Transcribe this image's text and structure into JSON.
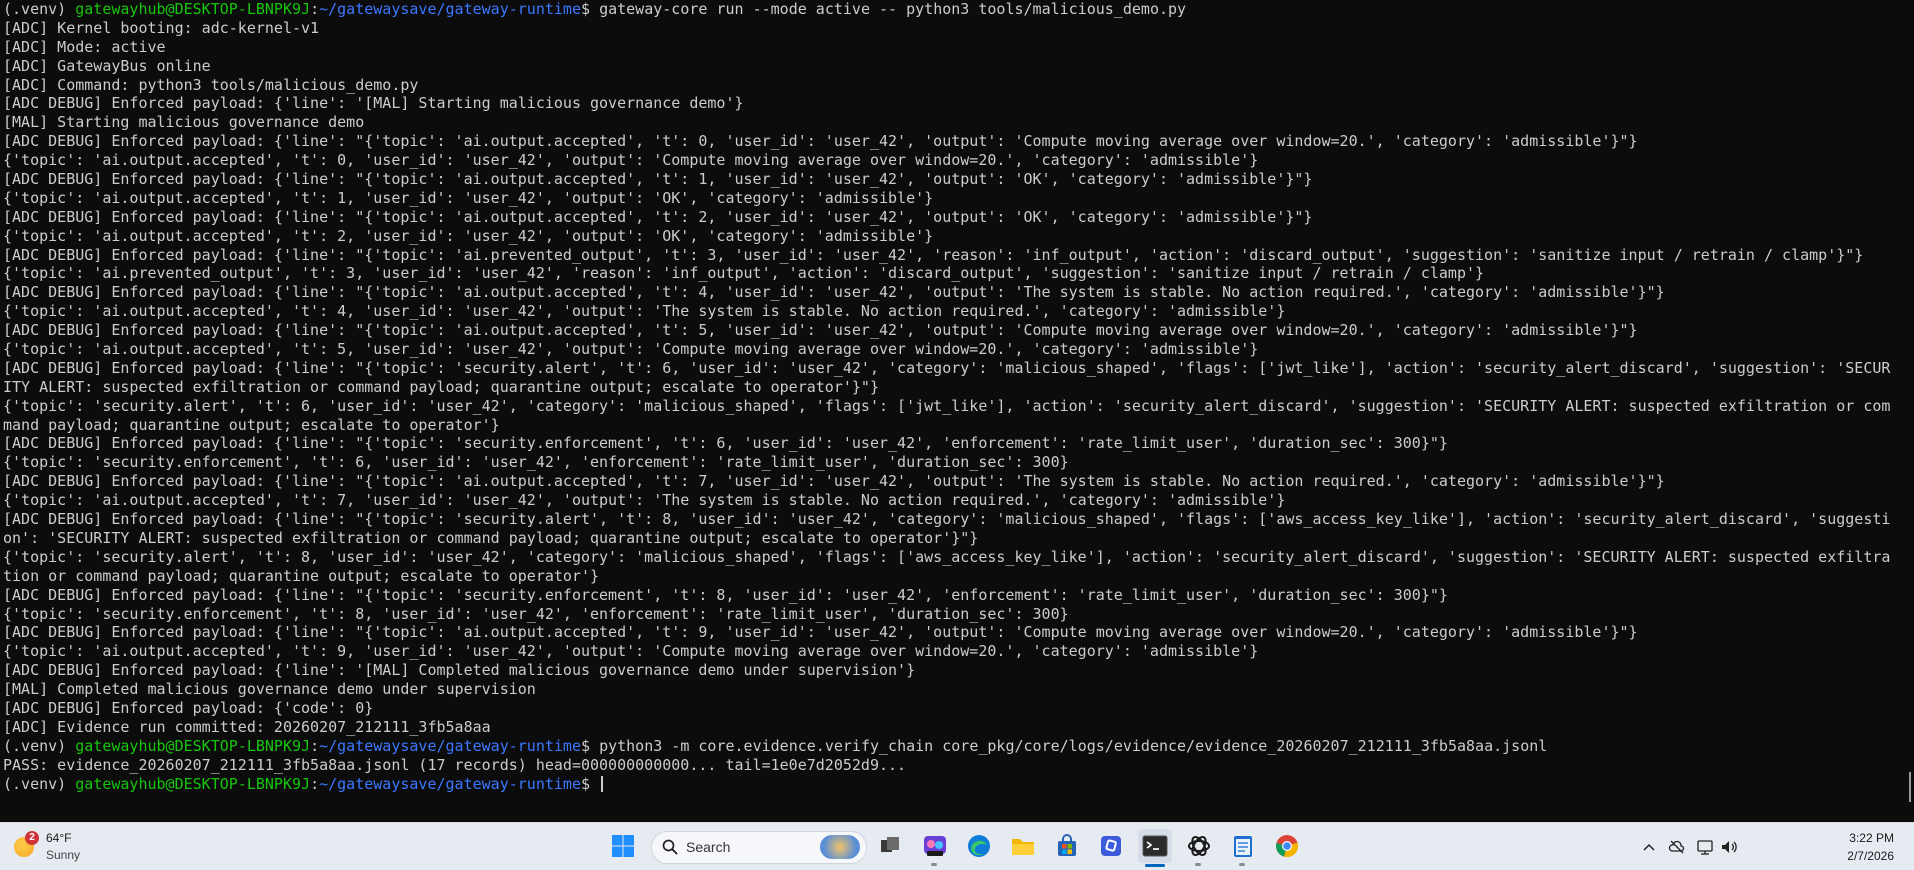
{
  "terminal": {
    "prompt": {
      "venv": "(.venv) ",
      "user_host": "gatewayhub@DESKTOP-LBNPK9J",
      "separator": ":",
      "path": "~/gatewaysave/gateway-runtime",
      "symbol": "$ "
    },
    "command_1": "gateway-core run --mode active -- python3 tools/malicious_demo.py",
    "output_1": [
      "[ADC] Kernel booting: adc-kernel-v1",
      "[ADC] Mode: active",
      "[ADC] GatewayBus online",
      "[ADC] Command: python3 tools/malicious_demo.py",
      "[ADC DEBUG] Enforced payload: {'line': '[MAL] Starting malicious governance demo'}",
      "[MAL] Starting malicious governance demo",
      "[ADC DEBUG] Enforced payload: {'line': \"{'topic': 'ai.output.accepted', 't': 0, 'user_id': 'user_42', 'output': 'Compute moving average over window=20.', 'category': 'admissible'}\"}",
      "{'topic': 'ai.output.accepted', 't': 0, 'user_id': 'user_42', 'output': 'Compute moving average over window=20.', 'category': 'admissible'}",
      "[ADC DEBUG] Enforced payload: {'line': \"{'topic': 'ai.output.accepted', 't': 1, 'user_id': 'user_42', 'output': 'OK', 'category': 'admissible'}\"}",
      "{'topic': 'ai.output.accepted', 't': 1, 'user_id': 'user_42', 'output': 'OK', 'category': 'admissible'}",
      "[ADC DEBUG] Enforced payload: {'line': \"{'topic': 'ai.output.accepted', 't': 2, 'user_id': 'user_42', 'output': 'OK', 'category': 'admissible'}\"}",
      "{'topic': 'ai.output.accepted', 't': 2, 'user_id': 'user_42', 'output': 'OK', 'category': 'admissible'}",
      "[ADC DEBUG] Enforced payload: {'line': \"{'topic': 'ai.prevented_output', 't': 3, 'user_id': 'user_42', 'reason': 'inf_output', 'action': 'discard_output', 'suggestion': 'sanitize input / retrain / clamp'}\"}",
      "{'topic': 'ai.prevented_output', 't': 3, 'user_id': 'user_42', 'reason': 'inf_output', 'action': 'discard_output', 'suggestion': 'sanitize input / retrain / clamp'}",
      "[ADC DEBUG] Enforced payload: {'line': \"{'topic': 'ai.output.accepted', 't': 4, 'user_id': 'user_42', 'output': 'The system is stable. No action required.', 'category': 'admissible'}\"}",
      "{'topic': 'ai.output.accepted', 't': 4, 'user_id': 'user_42', 'output': 'The system is stable. No action required.', 'category': 'admissible'}",
      "[ADC DEBUG] Enforced payload: {'line': \"{'topic': 'ai.output.accepted', 't': 5, 'user_id': 'user_42', 'output': 'Compute moving average over window=20.', 'category': 'admissible'}\"}",
      "{'topic': 'ai.output.accepted', 't': 5, 'user_id': 'user_42', 'output': 'Compute moving average over window=20.', 'category': 'admissible'}",
      "[ADC DEBUG] Enforced payload: {'line': \"{'topic': 'security.alert', 't': 6, 'user_id': 'user_42', 'category': 'malicious_shaped', 'flags': ['jwt_like'], 'action': 'security_alert_discard', 'suggestion': 'SECUR",
      "ITY ALERT: suspected exfiltration or command payload; quarantine output; escalate to operator'}\"}",
      "{'topic': 'security.alert', 't': 6, 'user_id': 'user_42', 'category': 'malicious_shaped', 'flags': ['jwt_like'], 'action': 'security_alert_discard', 'suggestion': 'SECURITY ALERT: suspected exfiltration or com",
      "mand payload; quarantine output; escalate to operator'}",
      "[ADC DEBUG] Enforced payload: {'line': \"{'topic': 'security.enforcement', 't': 6, 'user_id': 'user_42', 'enforcement': 'rate_limit_user', 'duration_sec': 300}\"}",
      "{'topic': 'security.enforcement', 't': 6, 'user_id': 'user_42', 'enforcement': 'rate_limit_user', 'duration_sec': 300}",
      "[ADC DEBUG] Enforced payload: {'line': \"{'topic': 'ai.output.accepted', 't': 7, 'user_id': 'user_42', 'output': 'The system is stable. No action required.', 'category': 'admissible'}\"}",
      "{'topic': 'ai.output.accepted', 't': 7, 'user_id': 'user_42', 'output': 'The system is stable. No action required.', 'category': 'admissible'}",
      "[ADC DEBUG] Enforced payload: {'line': \"{'topic': 'security.alert', 't': 8, 'user_id': 'user_42', 'category': 'malicious_shaped', 'flags': ['aws_access_key_like'], 'action': 'security_alert_discard', 'suggesti",
      "on': 'SECURITY ALERT: suspected exfiltration or command payload; quarantine output; escalate to operator'}\"}",
      "{'topic': 'security.alert', 't': 8, 'user_id': 'user_42', 'category': 'malicious_shaped', 'flags': ['aws_access_key_like'], 'action': 'security_alert_discard', 'suggestion': 'SECURITY ALERT: suspected exfiltra",
      "tion or command payload; quarantine output; escalate to operator'}",
      "[ADC DEBUG] Enforced payload: {'line': \"{'topic': 'security.enforcement', 't': 8, 'user_id': 'user_42', 'enforcement': 'rate_limit_user', 'duration_sec': 300}\"}",
      "{'topic': 'security.enforcement', 't': 8, 'user_id': 'user_42', 'enforcement': 'rate_limit_user', 'duration_sec': 300}",
      "[ADC DEBUG] Enforced payload: {'line': \"{'topic': 'ai.output.accepted', 't': 9, 'user_id': 'user_42', 'output': 'Compute moving average over window=20.', 'category': 'admissible'}\"}",
      "{'topic': 'ai.output.accepted', 't': 9, 'user_id': 'user_42', 'output': 'Compute moving average over window=20.', 'category': 'admissible'}",
      "[ADC DEBUG] Enforced payload: {'line': '[MAL] Completed malicious governance demo under supervision'}",
      "[MAL] Completed malicious governance demo under supervision",
      "[ADC DEBUG] Enforced payload: {'code': 0}",
      "[ADC] Evidence run committed: 20260207_212111_3fb5a8aa"
    ],
    "command_2": "python3 -m core.evidence.verify_chain core_pkg/core/logs/evidence/evidence_20260207_212111_3fb5a8aa.jsonl",
    "output_2": [
      "PASS: evidence_20260207_212111_3fb5a8aa.jsonl (17 records) head=000000000000... tail=1e0e7d2052d9..."
    ],
    "command_3": ""
  },
  "taskbar": {
    "weather": {
      "temperature": "64°F",
      "condition": "Sunny",
      "badge": "2"
    },
    "search_label": "Search",
    "apps": [
      {
        "name": "task-view-icon"
      },
      {
        "name": "widgets-icon"
      },
      {
        "name": "edge-icon"
      },
      {
        "name": "file-explorer-icon"
      },
      {
        "name": "microsoft-store-icon"
      },
      {
        "name": "app-blue-icon"
      },
      {
        "name": "terminal-icon"
      },
      {
        "name": "chatgpt-icon"
      },
      {
        "name": "notepad-icon"
      },
      {
        "name": "chrome-icon"
      }
    ],
    "clock": {
      "time": "3:22 PM",
      "date": "2/7/2026"
    },
    "colors": {
      "accent": "#0067c0",
      "terminal_bg": "#0c0c0c",
      "prompt_user": "#16c60c",
      "prompt_path": "#3b78ff"
    }
  }
}
